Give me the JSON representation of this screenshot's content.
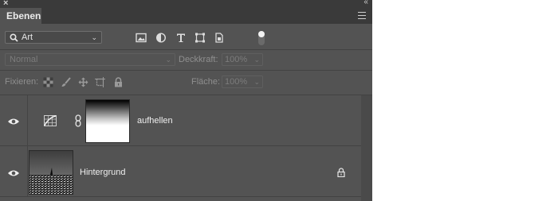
{
  "panel": {
    "close_glyph": "×",
    "collapse_glyph": "‹‹",
    "tab_label": "Ebenen"
  },
  "filter": {
    "kind_label": "Art",
    "icons": [
      "image-filter-icon",
      "adjustment-filter-icon",
      "type-filter-icon",
      "shape-filter-icon",
      "smartobject-filter-icon",
      "filter-toggle-icon"
    ]
  },
  "blend": {
    "mode": "Normal",
    "opacity_label": "Deckkraft:",
    "opacity_value": "100%"
  },
  "lock": {
    "label": "Fixieren:",
    "fill_label": "Fläche:",
    "fill_value": "100%"
  },
  "layers": [
    {
      "name": "aufhellen",
      "type": "adjustment-curves",
      "visible": true,
      "linked_mask": true
    },
    {
      "name": "Hintergrund",
      "type": "background",
      "visible": true,
      "locked": true
    }
  ],
  "colors": {
    "panel": "#535353",
    "header": "#3a3a3a",
    "text": "#eeeeee"
  }
}
